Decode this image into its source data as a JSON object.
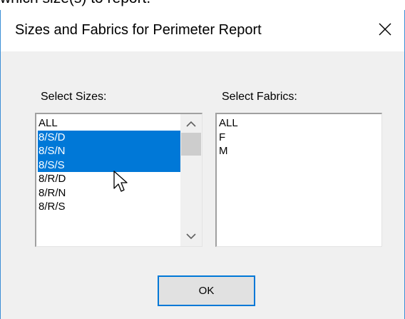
{
  "background": {
    "partial_text": "which size(s) to report."
  },
  "dialog": {
    "title": "Sizes and Fabrics for Perimeter Report",
    "close_icon": "close-icon",
    "sizes_label": "Select Sizes:",
    "fabrics_label": "Select Fabrics:",
    "sizes_list": {
      "items": [
        {
          "label": "ALL",
          "selected": false
        },
        {
          "label": "8/S/D",
          "selected": true
        },
        {
          "label": "8/S/N",
          "selected": true
        },
        {
          "label": "8/S/S",
          "selected": true
        },
        {
          "label": "8/R/D",
          "selected": false
        },
        {
          "label": "8/R/N",
          "selected": false
        },
        {
          "label": "8/R/S",
          "selected": false
        }
      ],
      "scroll_up_icon": "chevron-up-icon",
      "scroll_down_icon": "chevron-down-icon"
    },
    "fabrics_list": {
      "items": [
        {
          "label": "ALL",
          "selected": false
        },
        {
          "label": "F",
          "selected": false
        },
        {
          "label": "M",
          "selected": false
        }
      ]
    },
    "ok_label": "OK"
  },
  "colors": {
    "selection": "#0078d7",
    "window_border": "#3c8fd6",
    "dialog_bg": "#f0f0f0",
    "button_bg": "#e1e1e1"
  }
}
